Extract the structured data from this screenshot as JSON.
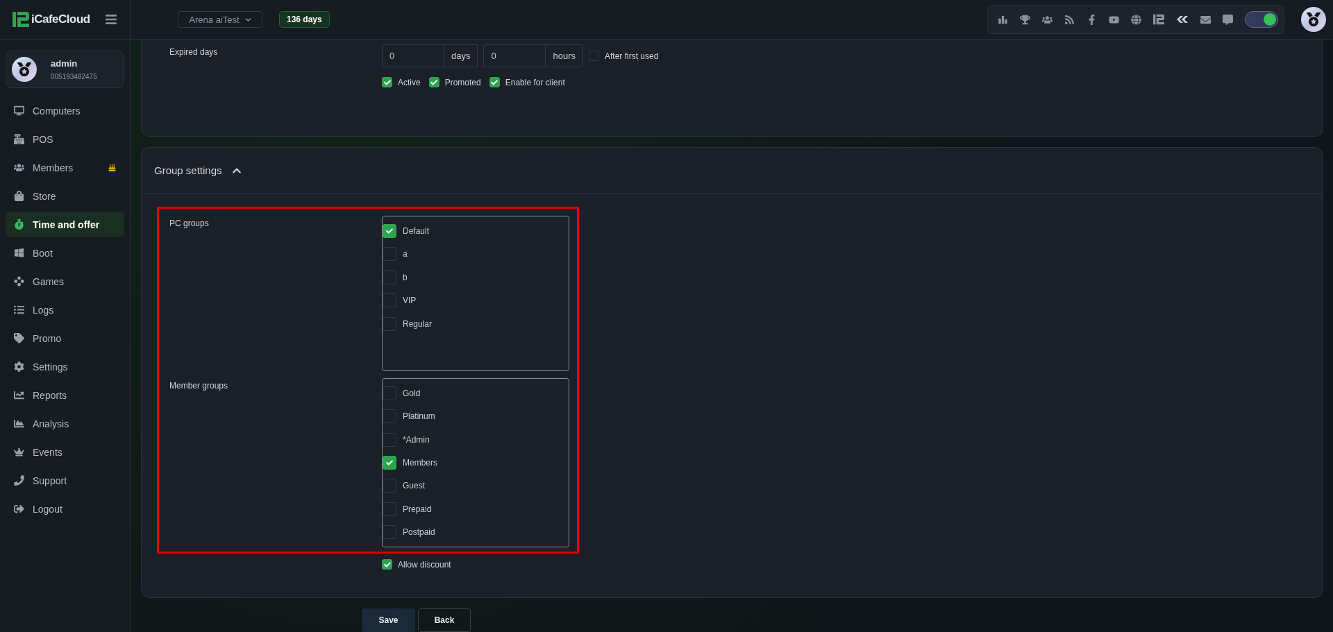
{
  "brand": {
    "name": "iCafeCloud"
  },
  "topbar": {
    "store": "Arena aiTest",
    "days_left": "136 days",
    "toggle_on": true
  },
  "user": {
    "name": "admin",
    "id": "005193482475"
  },
  "sidebar": {
    "items": [
      {
        "label": "Computers",
        "selected": false,
        "badge": false
      },
      {
        "label": "POS",
        "selected": false,
        "badge": false
      },
      {
        "label": "Members",
        "selected": false,
        "badge": true
      },
      {
        "label": "Store",
        "selected": false,
        "badge": false
      },
      {
        "label": "Time and offer",
        "selected": true,
        "badge": false
      },
      {
        "label": "Boot",
        "selected": false,
        "badge": false
      },
      {
        "label": "Games",
        "selected": false,
        "badge": false
      },
      {
        "label": "Logs",
        "selected": false,
        "badge": false
      },
      {
        "label": "Promo",
        "selected": false,
        "badge": false
      },
      {
        "label": "Settings",
        "selected": false,
        "badge": false
      },
      {
        "label": "Reports",
        "selected": false,
        "badge": false
      },
      {
        "label": "Analysis",
        "selected": false,
        "badge": false
      },
      {
        "label": "Events",
        "selected": false,
        "badge": false
      },
      {
        "label": "Support",
        "selected": false,
        "badge": false
      },
      {
        "label": "Logout",
        "selected": false,
        "badge": false
      }
    ]
  },
  "expiry": {
    "label": "Expired days",
    "days": {
      "value": "0",
      "unit": "days"
    },
    "hours": {
      "value": "0",
      "unit": "hours"
    },
    "after_first_used": {
      "label": "After first used",
      "checked": false
    },
    "flags": [
      {
        "label": "Active",
        "checked": true
      },
      {
        "label": "Promoted",
        "checked": true
      },
      {
        "label": "Enable for client",
        "checked": true
      }
    ]
  },
  "group_settings": {
    "title": "Group settings",
    "expanded": true,
    "pc_groups": {
      "label": "PC groups",
      "items": [
        {
          "label": "Default",
          "checked": true
        },
        {
          "label": "a",
          "checked": false
        },
        {
          "label": "b",
          "checked": false
        },
        {
          "label": "VIP",
          "checked": false
        },
        {
          "label": "Regular",
          "checked": false
        }
      ]
    },
    "member_groups": {
      "label": "Member groups",
      "items": [
        {
          "label": "Gold",
          "checked": false
        },
        {
          "label": "Platinum",
          "checked": false
        },
        {
          "label": "*Admin",
          "checked": false
        },
        {
          "label": "Members",
          "checked": true
        },
        {
          "label": "Guest",
          "checked": false
        },
        {
          "label": "Prepaid",
          "checked": false
        },
        {
          "label": "Postpaid",
          "checked": false
        }
      ]
    },
    "allow_discount": {
      "label": "Allow discount",
      "checked": true
    }
  },
  "buttons": [
    {
      "label": "Save",
      "kind": "primary"
    },
    {
      "label": "Back",
      "kind": "secondary"
    }
  ]
}
